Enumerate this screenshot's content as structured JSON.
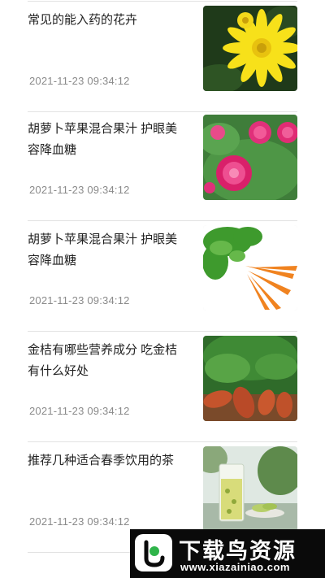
{
  "articles": [
    {
      "title": "常见的能入药的花卉",
      "date": "2021-11-23 09:34:12",
      "image": "yellow-chrysanthemum"
    },
    {
      "title": "胡萝卜苹果混合果汁 护眼美容降血糖",
      "date": "2021-11-23 09:34:12",
      "image": "pink-peony"
    },
    {
      "title": "胡萝卜苹果混合果汁 护眼美容降血糖",
      "date": "2021-11-23 09:34:12",
      "image": "carrots"
    },
    {
      "title": "金桔有哪些营养成分 吃金桔有什么好处",
      "date": "2021-11-23 09:34:12",
      "image": "sweet-potatoes"
    },
    {
      "title": "推荐几种适合春季饮用的茶",
      "date": "2021-11-23 09:34:12",
      "image": "green-tea-glass"
    }
  ],
  "watermark": {
    "main": "下载鸟资源",
    "url": "www.xiazainiao.com"
  }
}
